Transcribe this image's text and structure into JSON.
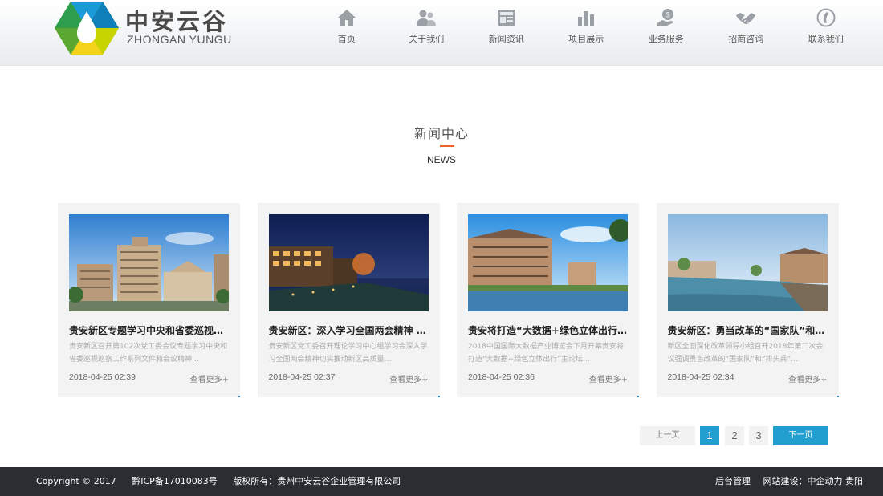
{
  "logo": {
    "cn": "中安云谷",
    "en": "ZHONGAN YUNGU"
  },
  "nav": [
    {
      "label": "首页",
      "icon": "home-icon"
    },
    {
      "label": "关于我们",
      "icon": "people-icon"
    },
    {
      "label": "新闻资讯",
      "icon": "newspaper-icon"
    },
    {
      "label": "项目展示",
      "icon": "bar-chart-icon"
    },
    {
      "label": "业务服务",
      "icon": "service-icon"
    },
    {
      "label": "招商咨询",
      "icon": "handshake-icon"
    },
    {
      "label": "联系我们",
      "icon": "phone-icon"
    }
  ],
  "section": {
    "title": "新闻中心",
    "subtitle": "NEWS"
  },
  "news": [
    {
      "title": "贵安新区专题学习中央和省委巡视巡察工作系列文件",
      "desc": "贵安新区召开第102次党工委会议专题学习中央和省委巡视巡察工作系列文件和会议精神…",
      "date": "2018-04-25 02:39",
      "more": "查看更多+"
    },
    {
      "title": "贵安新区：深入学习全国两会精神 推动高质量发展",
      "desc": "贵安新区党工委召开理论学习中心组学习会深入学习全国两会精神切实推动新区高质量…",
      "date": "2018-04-25 02:37",
      "more": "查看更多+"
    },
    {
      "title": "贵安将打造“大数据+绿色立体出行”主论坛",
      "desc": "2018中国国际大数据产业博览会下月开幕贵安将打造“大数据+绿色立体出行”主论坛…",
      "date": "2018-04-25 02:36",
      "more": "查看更多+"
    },
    {
      "title": "贵安新区：勇当改革的“国家队”和“排头兵”",
      "desc": "新区全面深化改革领导小组召开2018年第二次会议强调勇当改革的“国家队”和“排头兵”…",
      "date": "2018-04-25 02:34",
      "more": "查看更多+"
    }
  ],
  "pager": {
    "prev": "上一页",
    "p1": "1",
    "p2": "2",
    "p3": "3",
    "next": "下一页",
    "current": 1
  },
  "footer": {
    "copyright": "Copyright © 2017",
    "icp": "黔ICP备17010083号",
    "owner": "版权所有：贵州中安云谷企业管理有限公司",
    "admin": "后台管理",
    "builder": "网站建设：中企动力 贵阳"
  },
  "colors": {
    "accent": "#239fcf",
    "title_underline": "#e7632a",
    "footer_bg": "#2a2d31"
  }
}
